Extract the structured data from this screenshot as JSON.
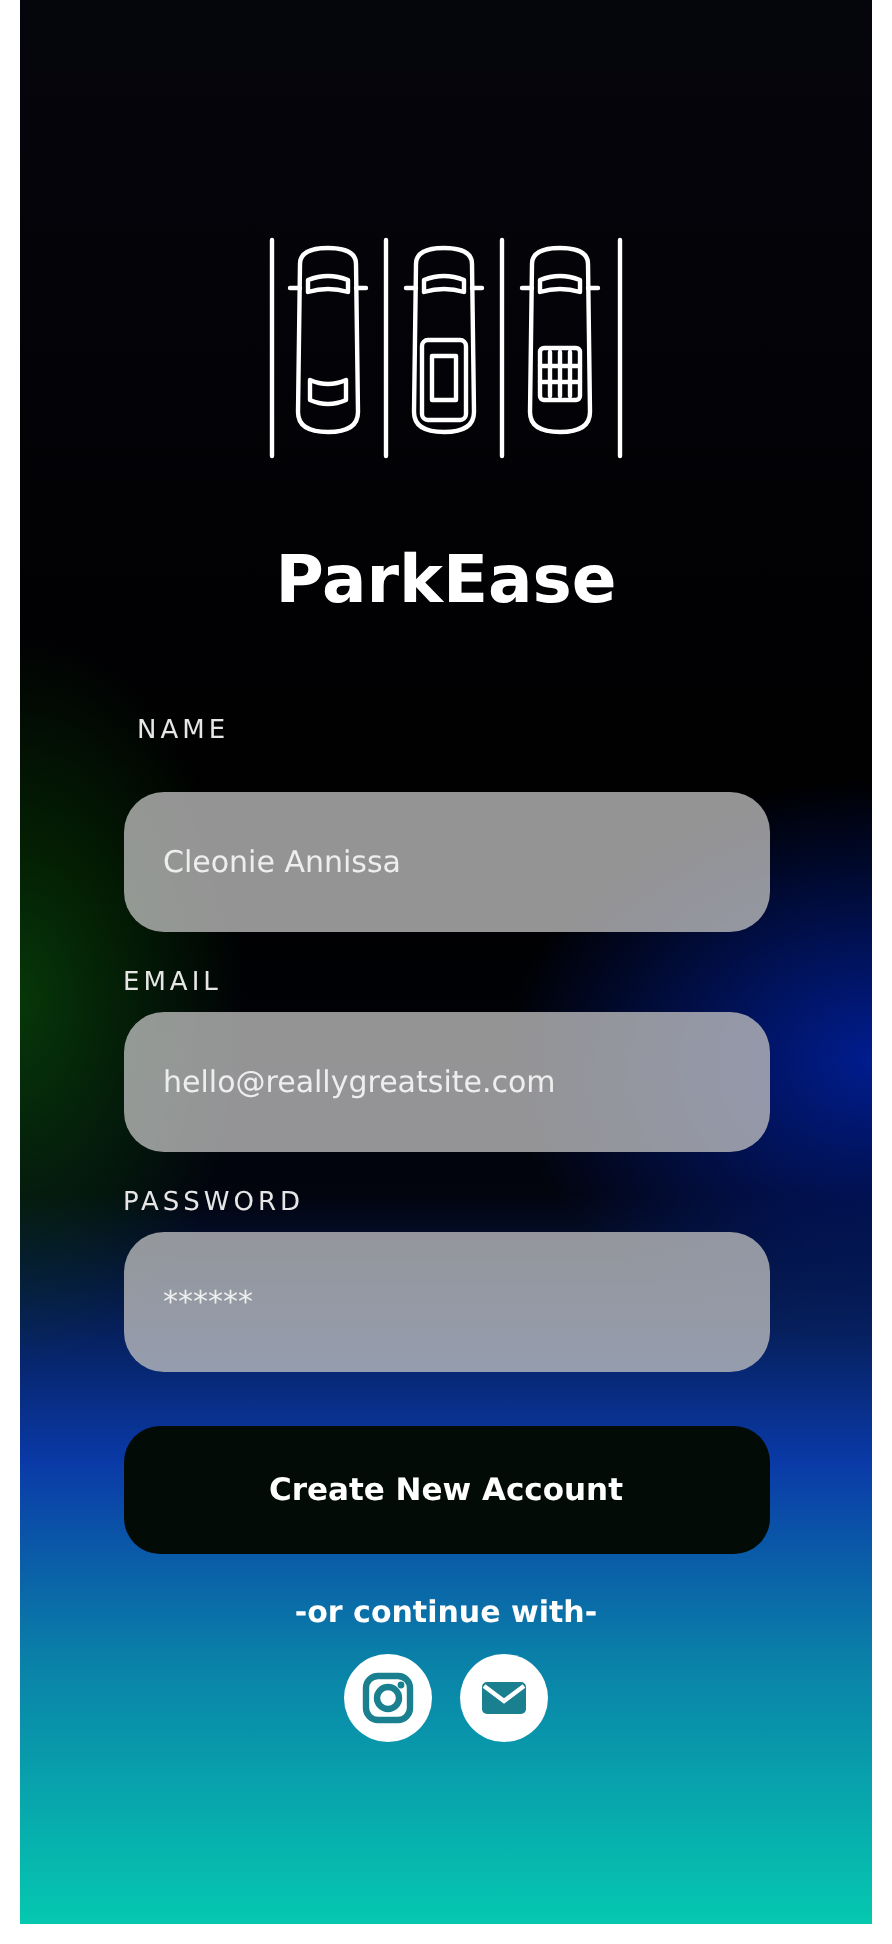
{
  "app_title": "ParkEase",
  "fields": [
    {
      "label": "NAME",
      "value": "Cleonie Annissa"
    },
    {
      "label": "EMAIL",
      "value": "hello@reallygreatsite.com"
    },
    {
      "label": "PASSWORD",
      "value": "******"
    }
  ],
  "submit_button": "Create New Account",
  "alt_login_text": "-or continue with-",
  "social_buttons": [
    {
      "kind": "instagram"
    },
    {
      "kind": "email"
    }
  ]
}
